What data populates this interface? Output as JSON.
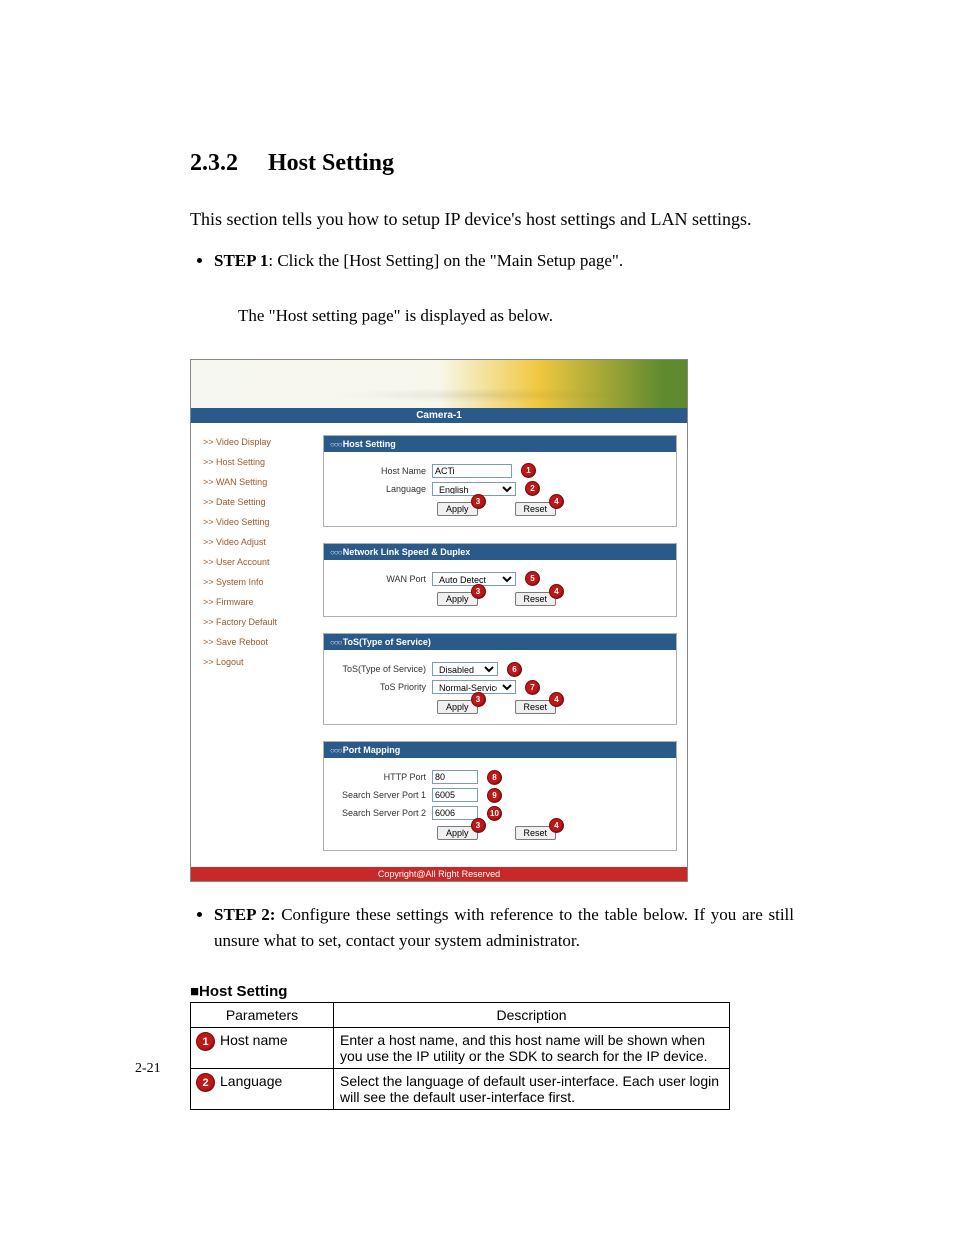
{
  "section_number": "2.3.2",
  "section_title": "Host Setting",
  "intro": "This section tells you how to setup IP device's host settings and LAN settings.",
  "step1_label": "STEP 1",
  "step1_text": ": Click the [Host Setting] on the \"Main Setup page\".",
  "step1_subtext": "The \"Host setting page\" is displayed as below.",
  "step2_label": "STEP 2:",
  "step2_text": " Configure these settings with reference to the table below. If you are still unsure what to set, contact your system administrator.",
  "page_number": "2-21",
  "screenshot": {
    "camera_label": "Camera-1",
    "sidebar": [
      ">> Video Display",
      ">> Host Setting",
      ">> WAN Setting",
      ">> Date Setting",
      ">> Video Setting",
      ">> Video Adjust",
      ">> User Account",
      ">> System Info",
      ">> Firmware",
      ">> Factory Default",
      ">> Save Reboot",
      ">> Logout"
    ],
    "host": {
      "title": "Host Setting",
      "hostname_label": "Host Name",
      "hostname_value": "ACTi",
      "language_label": "Language",
      "language_value": "English"
    },
    "link": {
      "title": "Network Link Speed & Duplex",
      "wan_label": "WAN Port",
      "wan_value": "Auto Detect"
    },
    "tos": {
      "title": "ToS(Type of Service)",
      "type_label": "ToS(Type of Service)",
      "type_value": "Disabled",
      "priority_label": "ToS Priority",
      "priority_value": "Normal-Service"
    },
    "port": {
      "title": "Port Mapping",
      "http_label": "HTTP Port",
      "http_value": "80",
      "s1_label": "Search Server Port 1",
      "s1_value": "6005",
      "s2_label": "Search Server Port 2",
      "s2_value": "6006"
    },
    "buttons": {
      "apply": "Apply",
      "reset": "Reset"
    },
    "markers": {
      "m1": "1",
      "m2": "2",
      "m3": "3",
      "m4": "4",
      "m5": "5",
      "m6": "6",
      "m7": "7",
      "m8": "8",
      "m9": "9",
      "m10": "10"
    },
    "copyright": "Copyright@All Right Reserved"
  },
  "table": {
    "heading": "■Host Setting",
    "col_param": "Parameters",
    "col_desc": "Description",
    "rows": [
      {
        "marker": "1",
        "param": "Host name",
        "desc": "Enter a host name, and this host name will be shown when you use the IP utility or the SDK to search for the IP device."
      },
      {
        "marker": "2",
        "param": "Language",
        "desc": "Select the language of default user-interface. Each user login will see the default user-interface first."
      }
    ]
  }
}
